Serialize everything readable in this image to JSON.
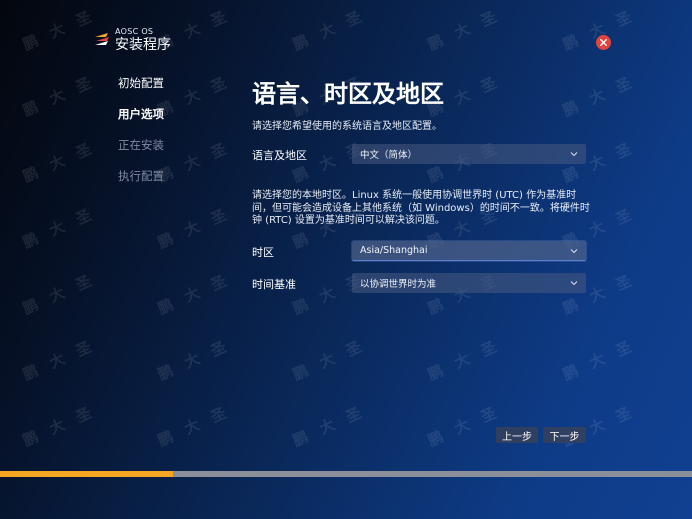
{
  "brand": {
    "small": "AOSC OS",
    "big": "安装程序"
  },
  "steps": [
    {
      "label": "初始配置",
      "state": "done"
    },
    {
      "label": "用户选项",
      "state": "active"
    },
    {
      "label": "正在安装",
      "state": "pending"
    },
    {
      "label": "执行配置",
      "state": "pending"
    }
  ],
  "main": {
    "title": "语言、时区及地区",
    "intro": "请选择您希望使用的系统语言及地区配置。",
    "language_label": "语言及地区",
    "language_value": "中文（简体）",
    "timezone_desc": "请选择您的本地时区。Linux 系统一般使用协调世界时 (UTC) 作为基准时间，但可能会造成设备上其他系统（如 Windows）的时间不一致。将硬件时钟 (RTC) 设置为基准时间可以解决该问题。",
    "timezone_label": "时区",
    "timezone_value": "Asia/Shanghai",
    "rtc_label": "时间基准",
    "rtc_value": "以协调世界时为准"
  },
  "nav": {
    "prev": "上一步",
    "next": "下一步"
  },
  "progress": 0.25,
  "watermark": "鹏大圣",
  "colors": {
    "accent": "#f5a623",
    "close": "#e0443e",
    "pending": "#7f8aa3"
  },
  "icons": {
    "close": "close-icon",
    "chevron": "chevron-down-icon",
    "logo": "aosc-logo-icon"
  }
}
